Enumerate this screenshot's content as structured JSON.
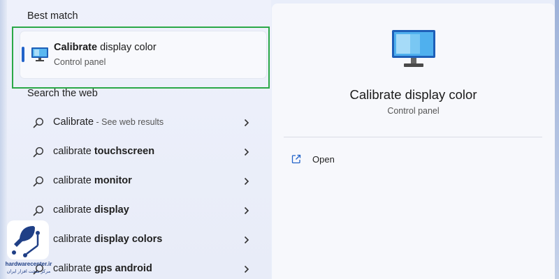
{
  "best_match": {
    "section_title": "Best match",
    "title_bold": "Calibrate",
    "title_rest": " display color",
    "subtitle": "Control panel",
    "icon": "monitor-icon"
  },
  "search_web": {
    "section_title": "Search the web",
    "items": [
      {
        "plain": "",
        "bold": "Calibrate",
        "suffix": " - See web results"
      },
      {
        "plain": "calibrate ",
        "bold": "touchscreen",
        "suffix": ""
      },
      {
        "plain": "calibrate ",
        "bold": "monitor",
        "suffix": ""
      },
      {
        "plain": "calibrate ",
        "bold": "display",
        "suffix": ""
      },
      {
        "plain": "calibrate ",
        "bold": "display colors",
        "suffix": ""
      },
      {
        "plain": "calibrate ",
        "bold": "gps android",
        "suffix": ""
      }
    ]
  },
  "preview": {
    "title": "Calibrate display color",
    "subtitle": "Control panel",
    "actions": [
      {
        "label": "Open",
        "icon": "external-link-icon"
      }
    ]
  },
  "watermark": {
    "brand": "hardwarecenter.ir",
    "tagline": "مرکز سخت افزار ایران"
  },
  "colors": {
    "accent": "#2263c9",
    "highlight_border": "#2aa847",
    "logo_blue": "#1f3f86"
  }
}
